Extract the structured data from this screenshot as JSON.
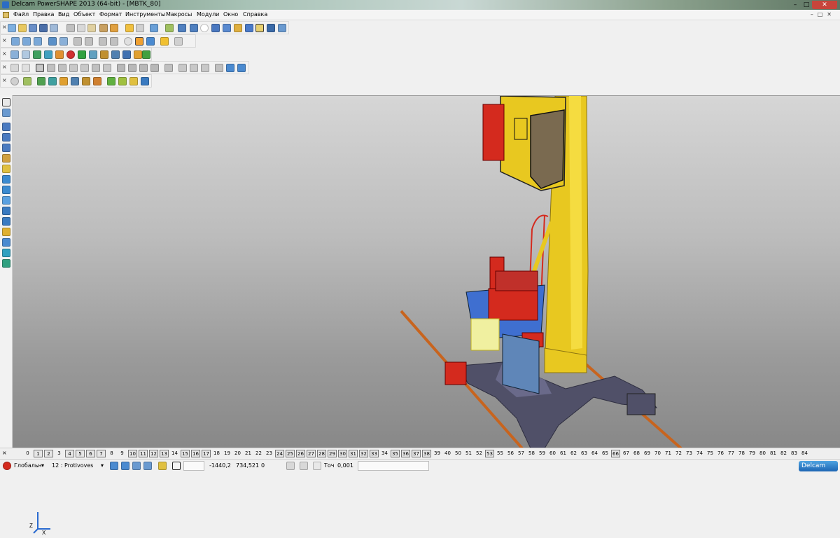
{
  "window": {
    "title": "Delcam PowerSHAPE 2013 (64-bit) - [MBTK_80]",
    "min_label": "–",
    "max_label": "□",
    "close_label": "✕"
  },
  "menu": {
    "items": [
      "Файл",
      "Правка",
      "Вид",
      "Объект",
      "Формат",
      "Инструменты",
      "Макросы",
      "Модули",
      "Окно",
      "Справка"
    ],
    "window_controls": "–□✕"
  },
  "toolbars": {
    "close_glyph": "×"
  },
  "levels": {
    "items": [
      "0",
      "1",
      "2",
      "3",
      "4",
      "5",
      "6",
      "7",
      "8",
      "9",
      "10",
      "11",
      "12",
      "13",
      "14",
      "15",
      "16",
      "17",
      "18",
      "19",
      "20",
      "21",
      "22",
      "23",
      "24",
      "25",
      "26",
      "27",
      "28",
      "29",
      "30",
      "31",
      "32",
      "33",
      "34",
      "35",
      "36",
      "37",
      "38",
      "39",
      "40",
      "50",
      "51",
      "52",
      "53",
      "55",
      "56",
      "57",
      "58",
      "59",
      "60",
      "61",
      "62",
      "63",
      "64",
      "65",
      "66",
      "67",
      "68",
      "69",
      "70",
      "71",
      "72",
      "73",
      "74",
      "75",
      "76",
      "77",
      "78",
      "79",
      "80",
      "81",
      "82",
      "83",
      "84"
    ],
    "boxed": [
      "1",
      "2",
      "4",
      "5",
      "6",
      "7",
      "10",
      "11",
      "12",
      "13",
      "15",
      "16",
      "17",
      "24",
      "25",
      "26",
      "27",
      "28",
      "29",
      "30",
      "31",
      "32",
      "33",
      "35",
      "36",
      "37",
      "38",
      "53",
      "66"
    ]
  },
  "status": {
    "workplane": "Глобальн",
    "level": "12 : Protivoves",
    "x": "-1440,2",
    "y": "734,521",
    "z": "0",
    "tol_label": "Точ",
    "tol_value": "0,001",
    "logo": "Delcam"
  },
  "viewport": {
    "axis_z": "Z",
    "axis_x": "X"
  },
  "colors": {
    "crane_yellow": "#e8c820",
    "machinery_red": "#d42a1e",
    "base_gray": "#505068",
    "rail_orange": "#c8641e",
    "deck_blue": "#3f6fd0",
    "cabinet_blue": "#5f86b8"
  }
}
